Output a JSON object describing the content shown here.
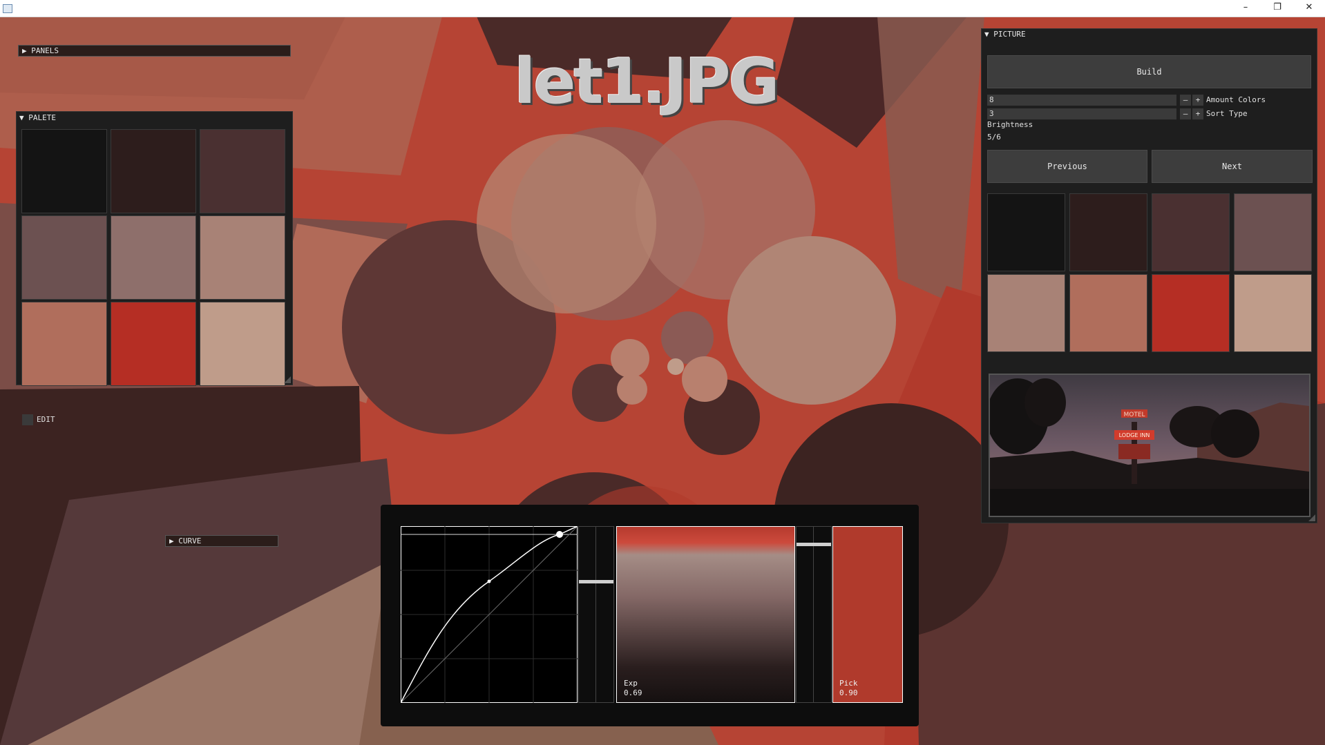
{
  "window": {
    "minimize": "–",
    "maximize": "❐",
    "close": "✕"
  },
  "canvas_title": "let1.JPG",
  "panels_header": "PANELS",
  "palete": {
    "header": "PALETE",
    "swatches": [
      "#141414",
      "#2d1d1c",
      "#4a3031",
      "#6c5151",
      "#8e6f6b",
      "#a88276",
      "#b06e5c",
      "#b52e24",
      "#bf9c8a"
    ],
    "edit_label": "EDIT"
  },
  "curve_header": "CURVE",
  "picture": {
    "header": "PICTURE",
    "build_label": "Build",
    "amount_colors_value": "8",
    "amount_colors_label": "Amount Colors",
    "sort_type_value": "3",
    "sort_type_label": "Sort Type",
    "minus": "–",
    "plus": "+",
    "brightness_label": "Brightness",
    "page_indicator": "5/6",
    "previous_label": "Previous",
    "next_label": "Next",
    "swatches": [
      "#141414",
      "#2d1d1c",
      "#4a3031",
      "#6c5151",
      "#a88276",
      "#b06e5c",
      "#b52e24",
      "#bf9c8a"
    ],
    "photo_sign_text": "MOTEL",
    "photo_sign_text2": "LODGE INN"
  },
  "curve_editor": {
    "exp_label": "Exp",
    "exp_value": "0.69",
    "pick_label": "Pick",
    "pick_value": "0.90",
    "pick_color": "#b03a2c"
  }
}
